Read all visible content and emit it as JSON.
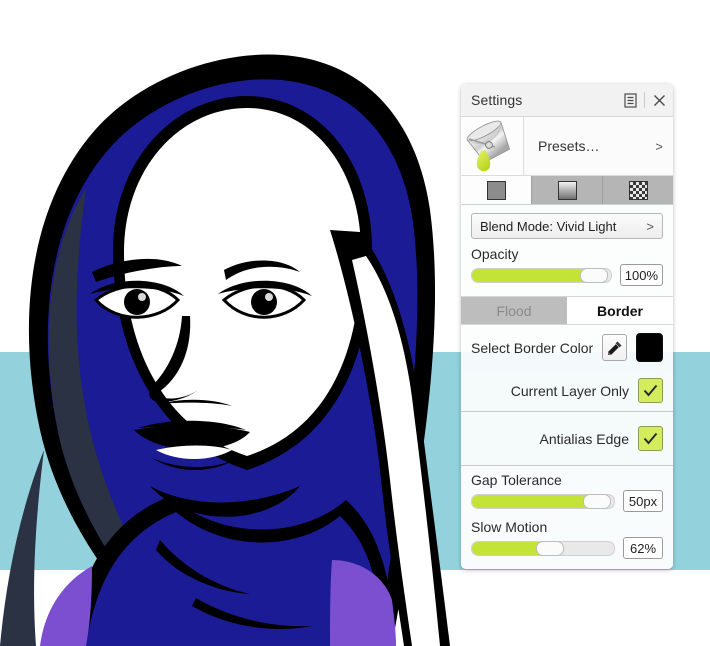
{
  "app": {
    "canvas_background": "#ffffff",
    "scene_band_color": "#93d2dc"
  },
  "artwork": {
    "name": "woman-in-hijab-line-art",
    "colors": {
      "outline": "#000000",
      "hijab_blue": "#1b1b96",
      "hijab_shadow": "#2a3244",
      "garment_purple": "#7b4fd0",
      "skin": "#ffffff",
      "backdrop_teal": "#93d2dc"
    }
  },
  "panel": {
    "titlebar": {
      "title": "Settings",
      "menu_icon": "document-list-icon",
      "close_icon": "close-icon"
    },
    "presets": {
      "label": "Presets…",
      "chevron": ">",
      "thumbnail_icon": "paint-bucket-icon"
    },
    "icon_tabs": [
      {
        "name": "solid-fill-tab",
        "icon": "solid-square-icon",
        "active": true
      },
      {
        "name": "gradient-fill-tab",
        "icon": "gradient-square-icon",
        "active": false
      },
      {
        "name": "pattern-fill-tab",
        "icon": "checkerboard-square-icon",
        "active": false
      }
    ],
    "blend_mode": {
      "label": "Blend Mode: Vivid Light",
      "chevron": ">"
    },
    "opacity": {
      "label": "Opacity",
      "value": "100%",
      "fill_percent": 88,
      "knob_percent": 88
    },
    "mode_tabs": [
      {
        "name": "flood-tab",
        "label": "Flood",
        "active": false
      },
      {
        "name": "border-tab",
        "label": "Border",
        "active": true
      }
    ],
    "border_color": {
      "label": "Select Border Color",
      "picker_icon": "eyedropper-icon",
      "swatch_color": "#000000"
    },
    "current_layer_only": {
      "label": "Current Layer Only",
      "checked": true,
      "check_glyph": "✓"
    },
    "antialias_edge": {
      "label": "Antialias Edge",
      "checked": true,
      "check_glyph": "✓"
    },
    "gap_tolerance": {
      "label": "Gap Tolerance",
      "value": "50px",
      "fill_percent": 86,
      "knob_percent": 88
    },
    "slow_motion": {
      "label": "Slow Motion",
      "value": "62%",
      "fill_percent": 52,
      "knob_percent": 55
    },
    "accent_color": "#c3e336",
    "checkbox_color": "#d2ec5e"
  }
}
